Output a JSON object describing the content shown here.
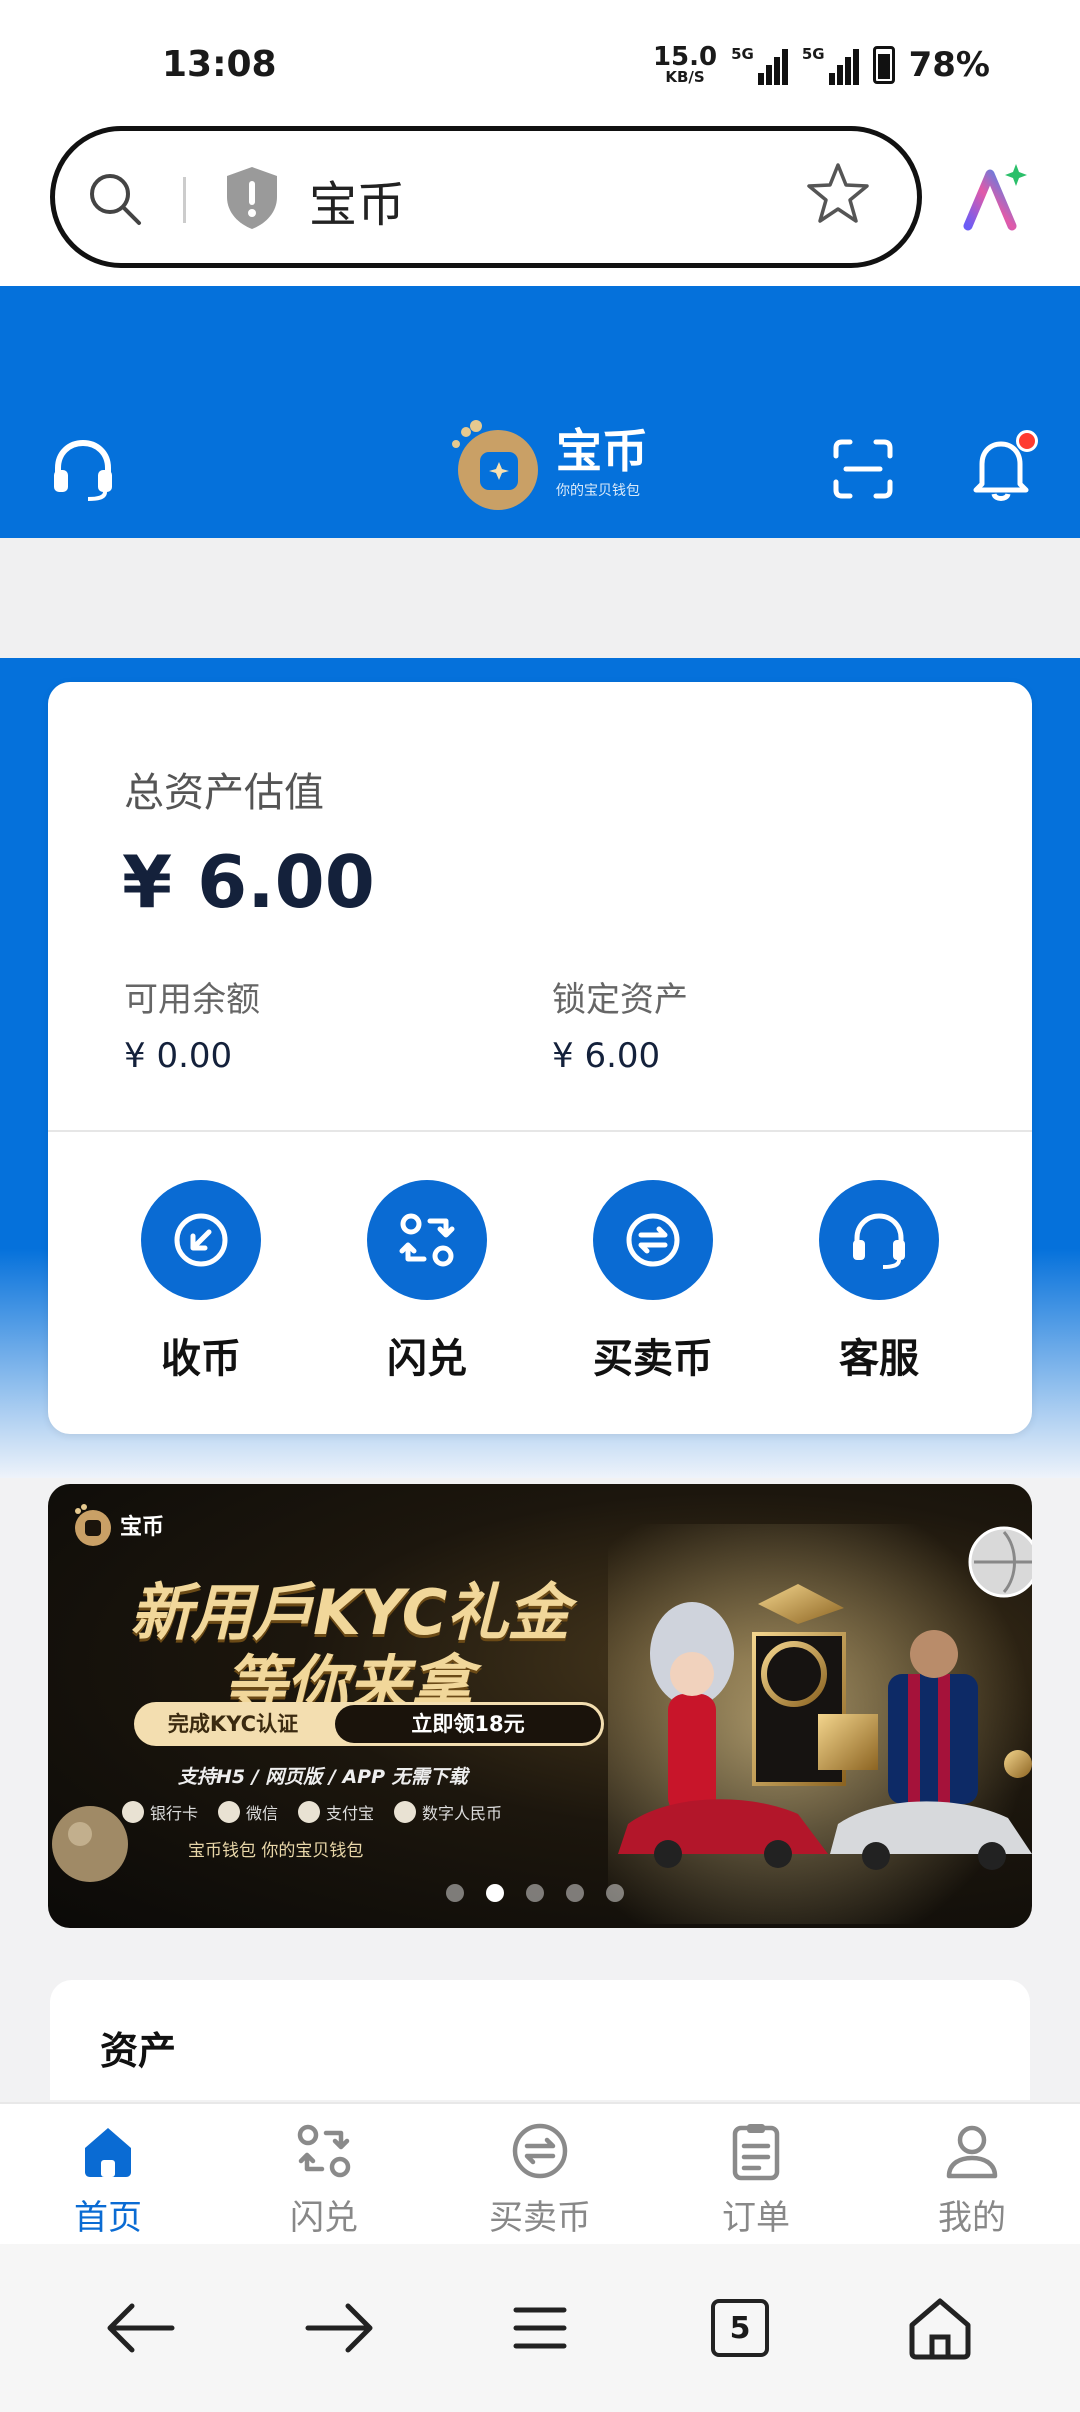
{
  "status_bar": {
    "time": "13:08",
    "net_speed_value": "15.0",
    "net_speed_unit": "KB/S",
    "sim1": "5G",
    "sim2": "5G",
    "battery": "78%"
  },
  "browser": {
    "url_text": "宝币",
    "tab_count": "5"
  },
  "app_header": {
    "logo_title": "宝币",
    "logo_subtitle": "你的宝贝钱包"
  },
  "asset_card": {
    "title": "总资产估值",
    "total": "¥ 6.00",
    "available_label": "可用余额",
    "available_value": "¥ 0.00",
    "locked_label": "锁定资产",
    "locked_value": "¥ 6.00",
    "actions": [
      {
        "label": "收币",
        "icon": "receive-icon"
      },
      {
        "label": "闪兑",
        "icon": "swap-icon"
      },
      {
        "label": "买卖币",
        "icon": "trade-icon"
      },
      {
        "label": "客服",
        "icon": "headset-icon"
      }
    ]
  },
  "banner": {
    "logo_title": "宝币",
    "headline_1": "新用戶KYC礼金",
    "headline_2": "等你来拿",
    "pill_left": "完成KYC认证",
    "pill_right": "立即领18元",
    "support": "支持H5 / 网页版 / APP 无需下载",
    "payments": [
      "银行卡",
      "微信",
      "支付宝",
      "数字人民币"
    ],
    "tagline": "宝币钱包 你的宝贝钱包",
    "slides": 5,
    "active_slide": 2
  },
  "assets_section": {
    "title": "资产"
  },
  "tabbar": {
    "tabs": [
      {
        "label": "首页",
        "icon": "home-icon",
        "active": true
      },
      {
        "label": "闪兑",
        "icon": "swap-icon",
        "active": false
      },
      {
        "label": "买卖币",
        "icon": "trade-icon",
        "active": false
      },
      {
        "label": "订单",
        "icon": "clipboard-icon",
        "active": false
      },
      {
        "label": "我的",
        "icon": "user-icon",
        "active": false
      }
    ]
  },
  "colors": {
    "brand_blue": "#0571db",
    "action_blue": "#0a6bd3",
    "gold": "#f1d79a"
  }
}
